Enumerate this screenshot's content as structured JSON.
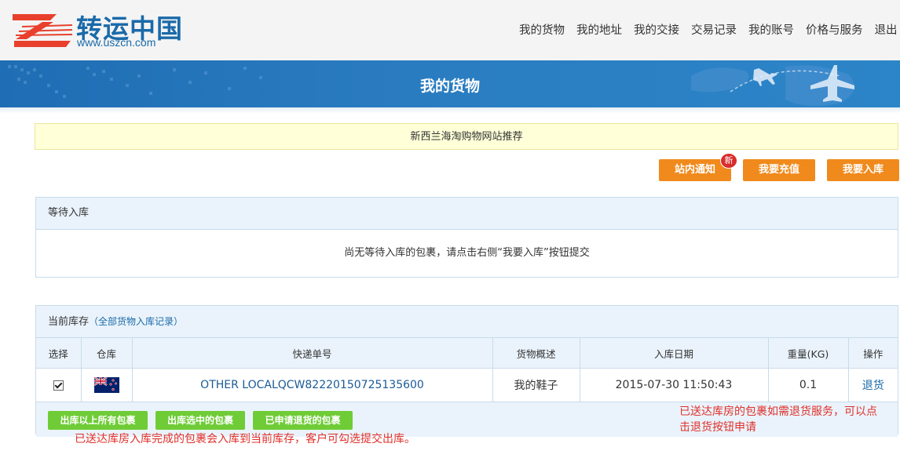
{
  "header": {
    "logo_cn": "转运中国",
    "logo_url": "www.uszcn.com",
    "nav": [
      "我的货物",
      "我的地址",
      "我的交接",
      "交易记录",
      "我的账号",
      "价格与服务",
      "退出"
    ]
  },
  "banner": {
    "title": "我的货物"
  },
  "promo": {
    "text": "新西兰海淘购物网站推荐"
  },
  "actions": {
    "notice_label": "站内通知",
    "notice_badge": "新",
    "recharge_label": "我要充值",
    "inbound_label": "我要入库"
  },
  "pending": {
    "title": "等待入库",
    "empty_message": "尚无等待入库的包裹，请点击右侧“我要入库”按钮提交"
  },
  "inventory": {
    "title": "当前库存",
    "paren_open": "（",
    "all_records_link": "全部货物入库记录",
    "paren_close": "）",
    "columns": [
      "选择",
      "仓库",
      "快递单号",
      "货物概述",
      "入库日期",
      "重量(KG)",
      "操作"
    ],
    "rows": [
      {
        "checked": true,
        "warehouse_flag": "new-zealand-flag",
        "tracking": "OTHER LOCALQCW82220150725135600",
        "description": "我的鞋子",
        "date": "2015-07-30 11:50:43",
        "weight": "0.1",
        "action": "退货"
      }
    ],
    "buttons": {
      "ship_all": "出库以上所有包裹",
      "ship_selected": "出库选中的包裹",
      "returns": "已申请退货的包裹"
    }
  },
  "notes": {
    "return_note_line1": "已送达库房的包裹如需退货服务，可以点",
    "return_note_line2": "击退货按钮申请",
    "stock_note": "已送达库房入库完成的包裹会入库到当前库存，客户可勾选提交出库。"
  },
  "colors": {
    "brand_blue": "#1a6aa9",
    "banner_blue": "#2a7cc0",
    "orange": "#f08a1c",
    "green": "#6fcc37",
    "red_note": "#e0302a"
  }
}
